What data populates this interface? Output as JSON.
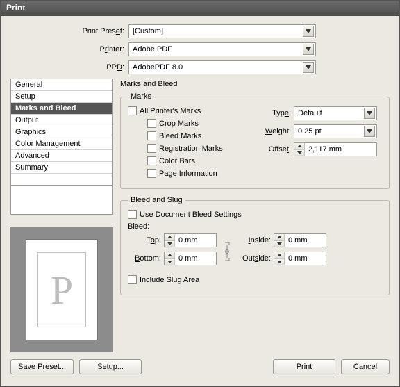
{
  "window": {
    "title": "Print"
  },
  "top": {
    "preset_label": "Print Preset:",
    "preset_underline": "e",
    "preset_value": "[Custom]",
    "printer_label_pre": "P",
    "printer_label_ul": "r",
    "printer_label_post": "inter:",
    "printer_value": "Adobe PDF",
    "ppd_label_pre": "PP",
    "ppd_label_ul": "D",
    "ppd_label_post": ":",
    "ppd_value": "AdobePDF 8.0"
  },
  "nav": {
    "items": [
      {
        "label": "General"
      },
      {
        "label": "Setup"
      },
      {
        "label": "Marks and Bleed",
        "selected": true
      },
      {
        "label": "Output"
      },
      {
        "label": "Graphics"
      },
      {
        "label": "Color Management"
      },
      {
        "label": "Advanced"
      },
      {
        "label": "Summary"
      }
    ]
  },
  "section": {
    "title": "Marks and Bleed"
  },
  "marks": {
    "legend": "Marks",
    "all_label_pre": "",
    "all_label_ul": "A",
    "all_label_post": "ll Printer's Marks",
    "crop": "Crop Marks",
    "bleed": "Bleed Marks",
    "reg": "Registration Marks",
    "bars": "Color Bars",
    "pageinfo": "Page Information",
    "type_label_pre": "Typ",
    "type_label_ul": "e",
    "type_label_post": ":",
    "type_value": "Default",
    "weight_label_ul": "W",
    "weight_label_post": "eight:",
    "weight_value": "0.25 pt",
    "offset_label_pre": "Offse",
    "offset_label_ul": "t",
    "offset_label_post": ":",
    "offset_value": "2,117 mm"
  },
  "bleed": {
    "legend": "Bleed and Slug",
    "usedoc_ul": "U",
    "usedoc_post": "se Document Bleed Settings",
    "bleed_label": "Bleed:",
    "top_pre": "T",
    "top_ul": "o",
    "top_post": "p:",
    "bottom_pre": "",
    "bottom_ul": "B",
    "bottom_post": "ottom:",
    "inside_pre": "",
    "inside_ul": "I",
    "inside_post": "nside:",
    "outside_pre": "Out",
    "outside_ul": "s",
    "outside_post": "ide:",
    "val_top": "0 mm",
    "val_bottom": "0 mm",
    "val_inside": "0 mm",
    "val_outside": "0 mm",
    "slug_pre": "Include Slu",
    "slug_ul": "g",
    "slug_post": " Area"
  },
  "buttons": {
    "save": "Save Preset...",
    "setup": "Setup...",
    "print": "Print",
    "cancel": "Cancel"
  },
  "preview": {
    "letter": "P"
  }
}
